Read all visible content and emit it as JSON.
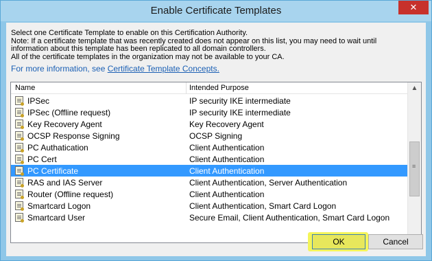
{
  "dialog": {
    "title": "Enable Certificate Templates",
    "close_label": "✕"
  },
  "description": {
    "line1": "Select one Certificate Template to enable on this Certification Authority.",
    "line2": "Note: If a certificate template that was recently created does not appear on this list, you may need to wait until",
    "line3": "information about this template has been replicated to all domain controllers.",
    "line4": "All of the certificate templates in the organization may not be available to your CA.",
    "more_prefix": "For more information, see ",
    "more_link": "Certificate Template Concepts."
  },
  "list": {
    "columns": {
      "name": "Name",
      "purpose": "Intended Purpose"
    },
    "rows": [
      {
        "name": "IPSec",
        "purpose": "IP security IKE intermediate"
      },
      {
        "name": "IPSec (Offline request)",
        "purpose": "IP security IKE intermediate"
      },
      {
        "name": "Key Recovery Agent",
        "purpose": "Key Recovery Agent"
      },
      {
        "name": "OCSP Response Signing",
        "purpose": "OCSP Signing"
      },
      {
        "name": "PC Authatication",
        "purpose": "Client Authentication"
      },
      {
        "name": "PC Cert",
        "purpose": "Client Authentication"
      },
      {
        "name": "PC Certificate",
        "purpose": "Client Authentication"
      },
      {
        "name": "RAS and IAS Server",
        "purpose": "Client Authentication, Server Authentication"
      },
      {
        "name": "Router (Offline request)",
        "purpose": "Client Authentication"
      },
      {
        "name": "Smartcard Logon",
        "purpose": "Client Authentication, Smart Card Logon"
      },
      {
        "name": "Smartcard User",
        "purpose": "Secure Email, Client Authentication, Smart Card Logon"
      }
    ],
    "selected_index": 6
  },
  "buttons": {
    "ok": "OK",
    "cancel": "Cancel"
  },
  "colors": {
    "selection": "#3399ff",
    "highlight": "#f4f55a",
    "link": "#1a5fb4"
  }
}
